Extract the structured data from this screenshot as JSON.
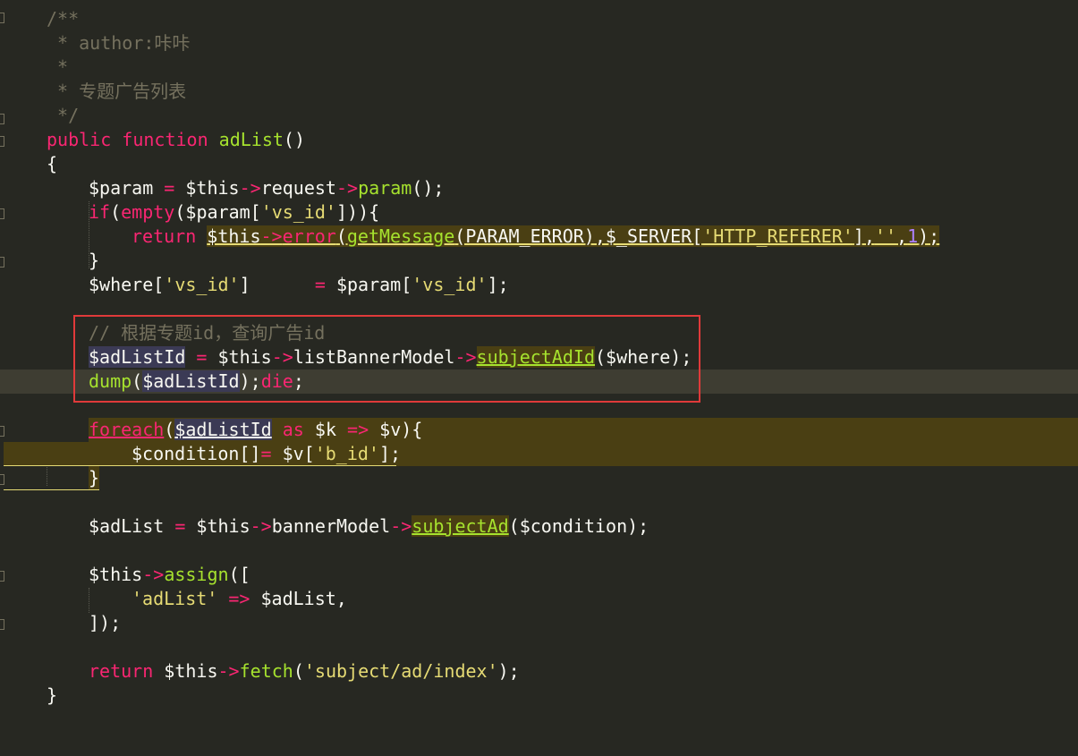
{
  "editor": {
    "theme_colors": {
      "background": "#272822",
      "comment": "#75715E",
      "keyword": "#F92672",
      "function": "#A6E22E",
      "string": "#E6DB74",
      "number": "#AE81FF",
      "plain": "#F8F8F2",
      "annotation_box": "#E03A3A"
    },
    "lines": {
      "l1": "/**",
      "l2": " * author:咔咔",
      "l3": " *",
      "l4": " * 专题广告列表",
      "l5": " */",
      "l6_kw1": "public",
      "l6_kw2": "function",
      "l6_name": "adList",
      "l6_paren": "()",
      "l7": "{",
      "l8": {
        "a": "$param",
        "b": " = ",
        "c": "$this",
        "d": "->",
        "e": "request",
        "f": "->",
        "g": "param",
        "h": "();"
      },
      "l9": {
        "a": "if",
        "b": "(",
        "c": "empty",
        "d": "($param[",
        "e": "'vs_id'",
        "f": "])){"
      },
      "l10": {
        "a": "return",
        "b": " ",
        "c": "$this",
        "d": "->",
        "e": "error",
        "f": "(",
        "g": "getMessage",
        "h": "(PARAM_ERROR),$_SERVER[",
        "i": "'HTTP_REFERER'",
        "j": "],",
        "k": "''",
        "l": ",",
        "m": "1",
        "n": ");"
      },
      "l11": "}",
      "l12": {
        "a": "$where[",
        "b": "'vs_id'",
        "c": "]",
        "d": "      = ",
        "e": "$param[",
        "f": "'vs_id'",
        "g": "];"
      },
      "l13": "// 根据专题id，查询广告id",
      "l14": {
        "a": "$adListId",
        "b": " = ",
        "c": "$this",
        "d": "->",
        "e": "listBannerModel",
        "f": "->",
        "g": "subjectAdId",
        "h": "($where);"
      },
      "l15": {
        "a": "dump",
        "b": "(",
        "c": "$adListId",
        "d": ");",
        "e": "die",
        "f": ";"
      },
      "l16": {
        "a": "foreach",
        "b": "(",
        "c": "$adListId",
        "d": " ",
        "e": "as",
        "f": " $k ",
        "g": "=>",
        "h": " $v){"
      },
      "l17": {
        "a": "$condition[]",
        "b": "=",
        "c": " $v[",
        "d": "'b_id'",
        "e": "];"
      },
      "l18": "}",
      "l19": {
        "a": "$adList",
        "b": " = ",
        "c": "$this",
        "d": "->",
        "e": "bannerModel",
        "f": "->",
        "g": "subjectAd",
        "h": "($condition);"
      },
      "l20": {
        "a": "$this",
        "b": "->",
        "c": "assign",
        "d": "(["
      },
      "l21": {
        "a": "'adList'",
        "b": " ",
        "c": "=>",
        "d": " $adList,"
      },
      "l22": "]);",
      "l23": {
        "a": "return",
        "b": " ",
        "c": "$this",
        "d": "->",
        "e": "fetch",
        "f": "(",
        "g": "'subject/ad/index'",
        "h": ");"
      },
      "l24": "}"
    }
  }
}
